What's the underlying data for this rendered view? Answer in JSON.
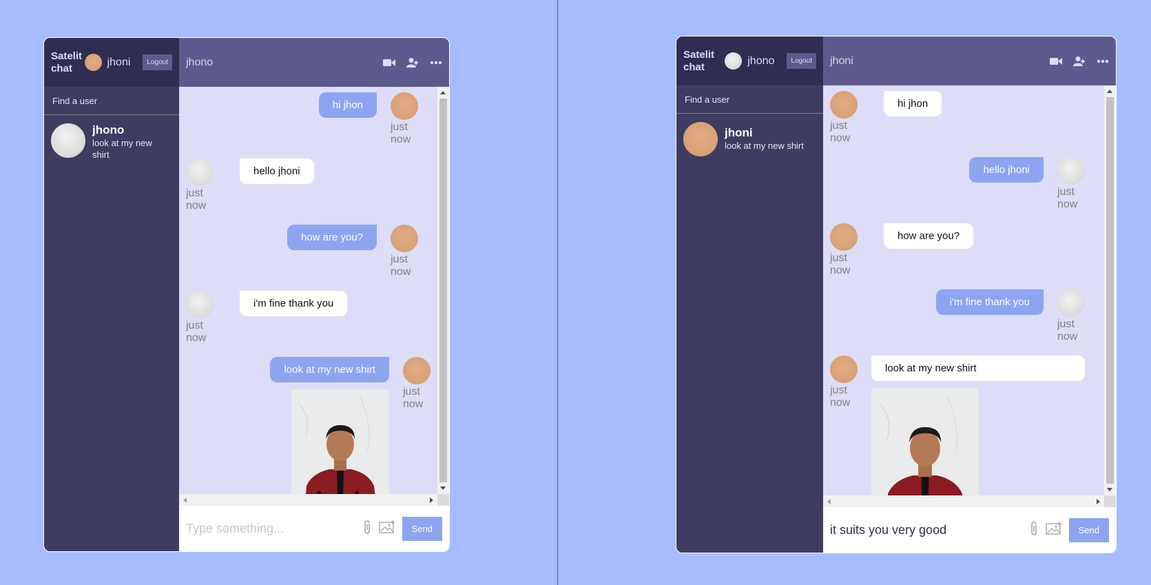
{
  "left": {
    "sidebar": {
      "logo": "Satelit chat",
      "current_user": "jhoni",
      "logout_label": "Logout",
      "search_label": "Find a user",
      "chats": [
        {
          "name": "jhono",
          "last_message": "look at my new shirt"
        }
      ]
    },
    "chat": {
      "title": "jhono",
      "messages": [
        {
          "owner": true,
          "text": "hi jhon",
          "time": "just now"
        },
        {
          "owner": false,
          "text": "hello jhoni",
          "time": "just now"
        },
        {
          "owner": true,
          "text": "how are you?",
          "time": "just now"
        },
        {
          "owner": false,
          "text": "i'm fine thank you",
          "time": "just now"
        },
        {
          "owner": true,
          "text": "look at my new shirt",
          "time": "just now",
          "has_image": true
        }
      ],
      "input": {
        "value": "",
        "placeholder": "Type something..."
      },
      "send_label": "Send"
    }
  },
  "right": {
    "sidebar": {
      "logo": "Satelit chat",
      "current_user": "jhono",
      "logout_label": "Logout",
      "search_label": "Find a user",
      "chats": [
        {
          "name": "jhoni",
          "last_message": "look at my new shirt"
        }
      ]
    },
    "chat": {
      "title": "jhoni",
      "messages": [
        {
          "owner": false,
          "text": "hi jhon",
          "time": "just now"
        },
        {
          "owner": true,
          "text": "hello jhoni",
          "time": "just now"
        },
        {
          "owner": false,
          "text": "how are you?",
          "time": "just now"
        },
        {
          "owner": true,
          "text": "i'm fine thank you",
          "time": "just now"
        },
        {
          "owner": false,
          "text": "look at my new shirt",
          "time": "just now",
          "has_image": true
        }
      ],
      "input": {
        "value": "it suits you very good",
        "placeholder": "Type something..."
      },
      "send_label": "Send"
    }
  },
  "colors": {
    "background": "#a7bcff",
    "sidebar": "#3e3c61",
    "navbar": "#2f2d52",
    "chat_header": "#5d5b8d",
    "chat_bg": "#ddddf7",
    "owner_bubble": "#8da4f1"
  },
  "icons": [
    "video-camera-icon",
    "add-user-icon",
    "more-icon",
    "attach-icon",
    "image-icon"
  ]
}
